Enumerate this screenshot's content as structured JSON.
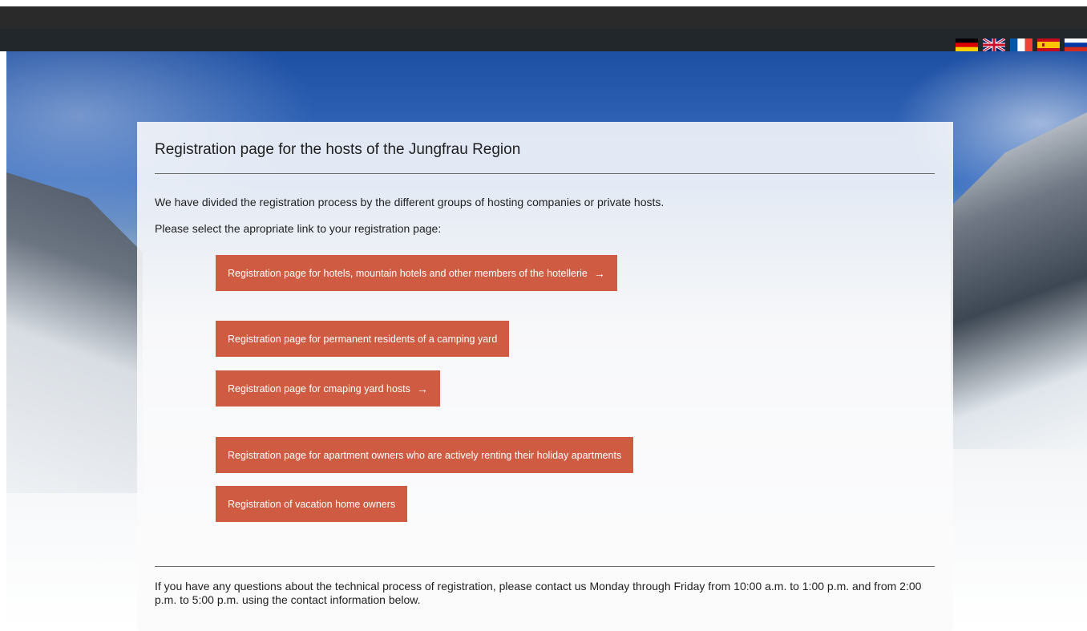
{
  "header": {
    "languages": [
      {
        "code": "de",
        "icon": "german-flag-icon"
      },
      {
        "code": "en",
        "icon": "uk-flag-icon"
      },
      {
        "code": "fr",
        "icon": "french-flag-icon"
      },
      {
        "code": "es",
        "icon": "spanish-flag-icon"
      },
      {
        "code": "ru",
        "icon": "russian-flag-icon"
      }
    ]
  },
  "main": {
    "title": "Registration page for the hosts of the Jungfrau Region",
    "intro_line1": "We have divided the registration process by the different groups of hosting companies or private hosts.",
    "intro_line2": "Please select the apropriate link to your registration page:",
    "buttons": [
      {
        "label": "Registration page for hotels, mountain hotels and other members of the hotellerie",
        "arrow": "→"
      },
      {
        "label": "Registration page for permanent residents of a camping yard"
      },
      {
        "label": "Registration page for cmaping yard hosts",
        "arrow": "→"
      },
      {
        "label": "Registration page for apartment owners who are actively renting their holiday apartments"
      },
      {
        "label": "Registration of vacation home owners"
      }
    ],
    "contact_text": "If you have any questions about the technical process of registration, please contact us Monday through Friday from 10:00 a.m. to 1:00 p.m. and from 2:00 p.m. to 5:00 p.m. using the contact information below."
  },
  "colors": {
    "button_bg": "#cf5b43",
    "topbar_bg": "#2a2a2a",
    "sky": "#1d4fa3"
  }
}
